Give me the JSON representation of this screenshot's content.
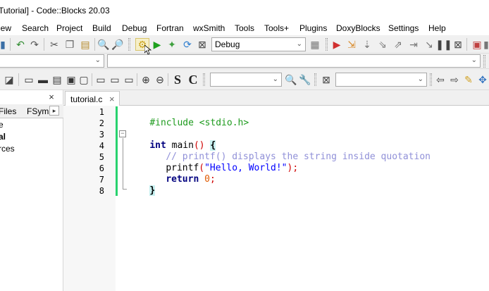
{
  "window": {
    "title": "Tutorial] - Code::Blocks 20.03"
  },
  "menu": [
    "iew",
    "Search",
    "Project",
    "Build",
    "Debug",
    "Fortran",
    "wxSmith",
    "Tools",
    "Tools+",
    "Plugins",
    "DoxyBlocks",
    "Settings",
    "Help"
  ],
  "toolbar": {
    "build_target": "Debug"
  },
  "search_toolbar": {
    "find_combo": "",
    "regex_combo": ""
  },
  "left_panel": {
    "close_glyph": "×",
    "tabs": [
      "Files",
      "FSym"
    ],
    "tree": [
      "e",
      "al",
      "rces"
    ]
  },
  "editor": {
    "tab_label": "tutorial.c",
    "tab_close": "×",
    "line_numbers": [
      "1",
      "2",
      "3",
      "4",
      "5",
      "6",
      "7",
      "8"
    ],
    "code": {
      "l1": "#include <stdio.h>",
      "l3_kw": "int",
      "l3_rest": " main",
      "l3_paren": "()",
      "l3_brace": "{",
      "l4": "// printf() displays the string inside quotation",
      "l5_fn": "printf",
      "l5_open": "(",
      "l5_str": "\"Hello, World!\"",
      "l5_close": ");",
      "l6_kw": "return",
      "l6_num": "0",
      "l6_semi": ";",
      "l7_brace": "}"
    }
  },
  "colors": {
    "change_bar": "#28d26e",
    "preprocessor": "#1e9b1e",
    "keyword": "#00007f",
    "comment": "#9090d8",
    "string": "#0000ff"
  }
}
